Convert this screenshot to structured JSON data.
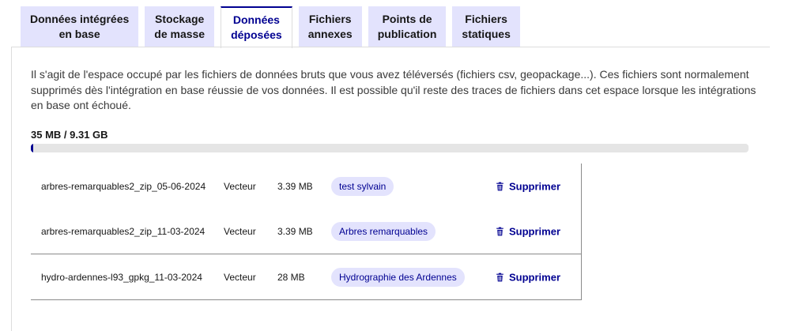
{
  "tabs": [
    {
      "line1": "Données intégrées",
      "line2": "en base",
      "active": false
    },
    {
      "line1": "Stockage",
      "line2": "de masse",
      "active": false
    },
    {
      "line1": "Données",
      "line2": "déposées",
      "active": true
    },
    {
      "line1": "Fichiers",
      "line2": "annexes",
      "active": false
    },
    {
      "line1": "Points de",
      "line2": "publication",
      "active": false
    },
    {
      "line1": "Fichiers",
      "line2": "statiques",
      "active": false
    }
  ],
  "description": "Il s'agit de l'espace occupé par les fichiers de données bruts que vous avez téléversés (fichiers csv, geopackage...). Ces fichiers sont normalement supprimés dès l'intégration en base réussie de vos données. Il est possible qu'il reste des traces de fichiers dans cet espace lorsque les intégrations en base ont échoué.",
  "usage": {
    "label": "35 MB / 9.31 GB",
    "fraction": 0.0037
  },
  "files": [
    {
      "name": "arbres-remarquables2_zip_05-06-2024",
      "type": "Vecteur",
      "size": "3.39 MB",
      "tag": "test sylvain",
      "delete_label": "Supprimer"
    },
    {
      "name": "arbres-remarquables2_zip_11-03-2024",
      "type": "Vecteur",
      "size": "3.39 MB",
      "tag": "Arbres remarquables",
      "delete_label": "Supprimer"
    },
    {
      "name": "hydro-ardennes-l93_gpkg_11-03-2024",
      "type": "Vecteur",
      "size": "28 MB",
      "tag": "Hydrographie des Ardennes",
      "delete_label": "Supprimer"
    }
  ],
  "icons": {
    "delete": "trash-icon"
  },
  "colors": {
    "accent": "#000091",
    "tab_bg": "#e3e3fd",
    "progress_bg": "#e5e5e5"
  }
}
